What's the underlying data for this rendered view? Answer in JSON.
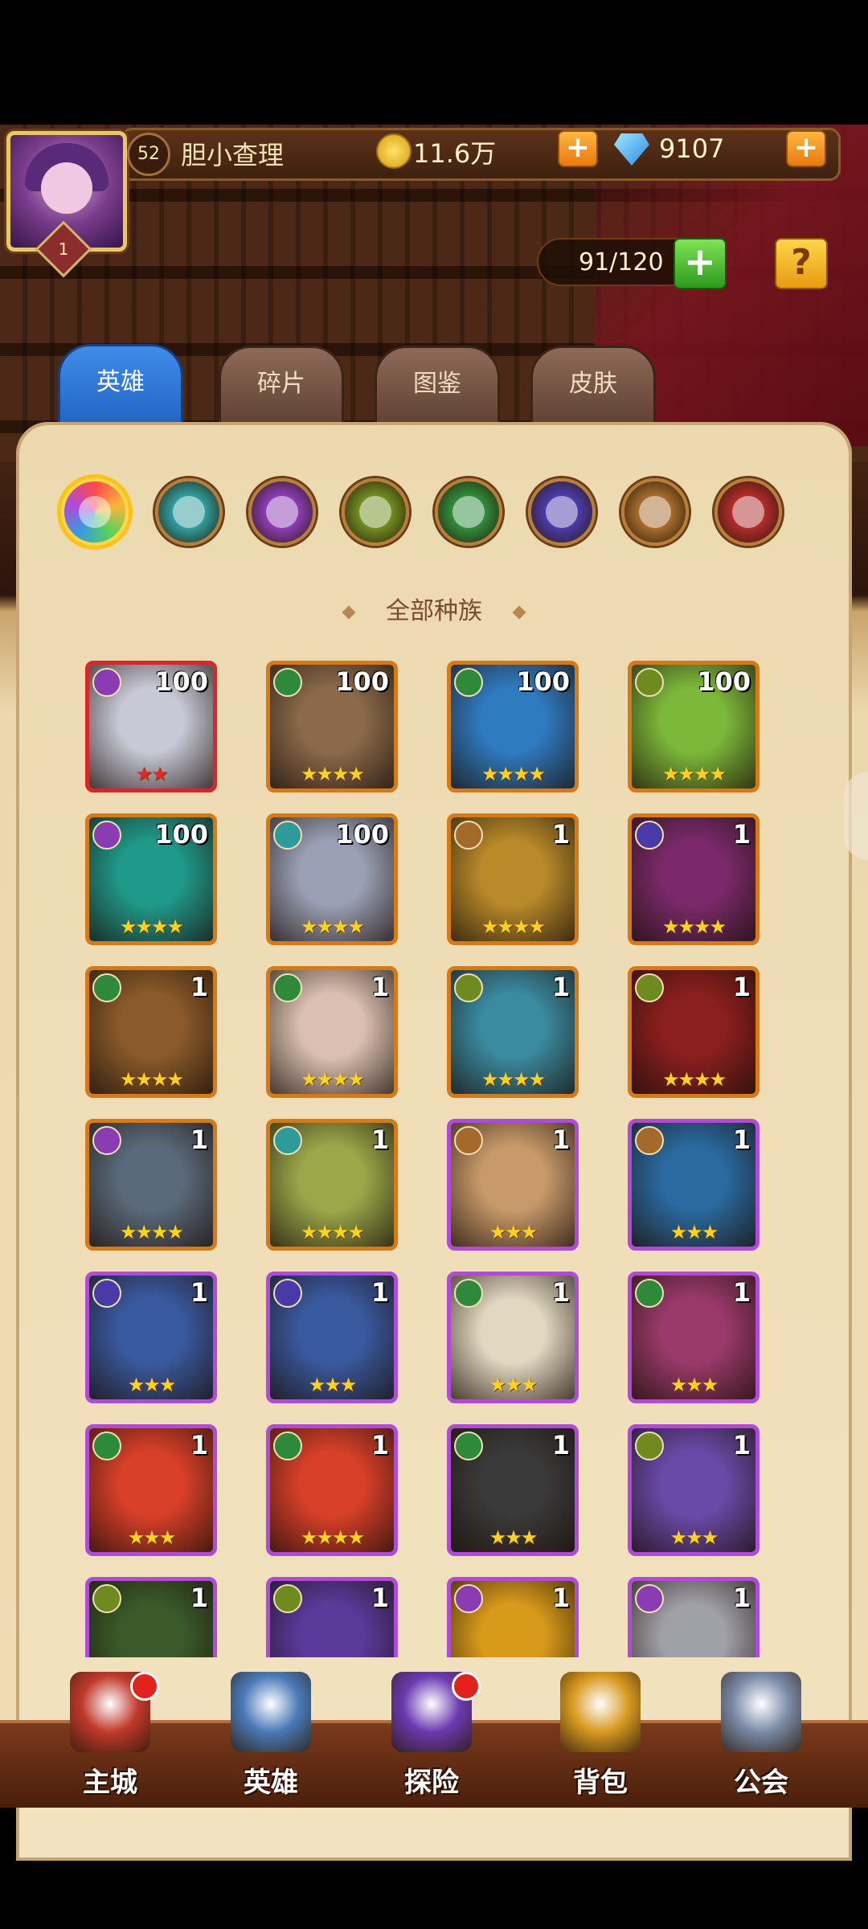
{
  "player": {
    "level": "52",
    "name": "胆小查理",
    "rank": "1"
  },
  "currency": {
    "gold": "11.6万",
    "gems": "9107"
  },
  "roster": {
    "count": "91/120"
  },
  "tabs": [
    "英雄",
    "碎片",
    "图鉴",
    "皮肤"
  ],
  "race_filter": {
    "title": "全部种族",
    "icons": [
      "all-races-icon",
      "race-blue-icon",
      "race-purple-icon",
      "race-olive-icon",
      "race-green-icon",
      "race-indigo-icon",
      "race-bronze-icon",
      "race-red-icon"
    ],
    "colors": [
      "#ff7e3a",
      "#2f9a9a",
      "#8a3cb2",
      "#6f8a1f",
      "#2e8a3a",
      "#4a3aa8",
      "#a46a2c",
      "#b02a2a"
    ]
  },
  "heroes": [
    {
      "level": "100",
      "stars": "★★",
      "frame": "red",
      "race": "#8a3cb2",
      "bg": "#c7c9d6"
    },
    {
      "level": "100",
      "stars": "★★★★",
      "frame": "orange",
      "race": "#2e8a3a",
      "bg": "#8a6a4a"
    },
    {
      "level": "100",
      "stars": "★★★★",
      "frame": "orange",
      "race": "#2e8a3a",
      "bg": "#2f7bc0"
    },
    {
      "level": "100",
      "stars": "★★★★",
      "frame": "orange",
      "race": "#6f8a1f",
      "bg": "#7cb83a"
    },
    {
      "level": "100",
      "stars": "★★★★",
      "frame": "orange",
      "race": "#8a3cb2",
      "bg": "#1f9a8a"
    },
    {
      "level": "100",
      "stars": "★★★★",
      "frame": "orange",
      "race": "#2f9a9a",
      "bg": "#9aa0b5"
    },
    {
      "level": "1",
      "stars": "★★★★",
      "frame": "orange",
      "race": "#a46a2c",
      "bg": "#b88a2a"
    },
    {
      "level": "1",
      "stars": "★★★★",
      "frame": "orange",
      "race": "#4a3aa8",
      "bg": "#7a2a6a"
    },
    {
      "level": "1",
      "stars": "★★★★",
      "frame": "orange",
      "race": "#2e8a3a",
      "bg": "#8a5a2a"
    },
    {
      "level": "1",
      "stars": "★★★★",
      "frame": "orange",
      "race": "#2e8a3a",
      "bg": "#d9c0b0"
    },
    {
      "level": "1",
      "stars": "★★★★",
      "frame": "orange",
      "race": "#6f8a1f",
      "bg": "#3a8aa0"
    },
    {
      "level": "1",
      "stars": "★★★★",
      "frame": "orange",
      "race": "#6f8a1f",
      "bg": "#8a1f1f"
    },
    {
      "level": "1",
      "stars": "★★★★",
      "frame": "orange",
      "race": "#8a3cb2",
      "bg": "#5a6a7a"
    },
    {
      "level": "1",
      "stars": "★★★★",
      "frame": "orange",
      "race": "#2f9a9a",
      "bg": "#9aa84a"
    },
    {
      "level": "1",
      "stars": "★★★",
      "frame": "purple",
      "race": "#a46a2c",
      "bg": "#c89a6a"
    },
    {
      "level": "1",
      "stars": "★★★",
      "frame": "purple",
      "race": "#a46a2c",
      "bg": "#2a6aa0"
    },
    {
      "level": "1",
      "stars": "★★★",
      "frame": "purple",
      "race": "#4a3aa8",
      "bg": "#3a5aa0"
    },
    {
      "level": "1",
      "stars": "★★★",
      "frame": "purple",
      "race": "#4a3aa8",
      "bg": "#3a5aa0"
    },
    {
      "level": "1",
      "stars": "★★★",
      "frame": "purple",
      "race": "#2e8a3a",
      "bg": "#e0d8c0"
    },
    {
      "level": "1",
      "stars": "★★★",
      "frame": "purple",
      "race": "#2e8a3a",
      "bg": "#9a3a6a"
    },
    {
      "level": "1",
      "stars": "★★★",
      "frame": "purple",
      "race": "#2e8a3a",
      "bg": "#d8402a"
    },
    {
      "level": "1",
      "stars": "★★★★",
      "frame": "purple",
      "race": "#2e8a3a",
      "bg": "#d8402a"
    },
    {
      "level": "1",
      "stars": "★★★",
      "frame": "purple",
      "race": "#2e8a3a",
      "bg": "#3a3a3a"
    },
    {
      "level": "1",
      "stars": "★★★",
      "frame": "purple",
      "race": "#6f8a1f",
      "bg": "#6a4aa8"
    },
    {
      "level": "1",
      "stars": "★★★",
      "frame": "purple",
      "race": "#6f8a1f",
      "bg": "#3a5a2a"
    },
    {
      "level": "1",
      "stars": "★★★",
      "frame": "purple",
      "race": "#6f8a1f",
      "bg": "#5a3a9a"
    },
    {
      "level": "1",
      "stars": "★★★",
      "frame": "purple",
      "race": "#8a3cb2",
      "bg": "#d89a1a"
    },
    {
      "level": "1",
      "stars": "★★★",
      "frame": "purple",
      "race": "#8a3cb2",
      "bg": "#a0a0a8"
    }
  ],
  "nav": [
    {
      "label": "主城",
      "icon": "castle-icon",
      "badge": true,
      "color": "#c0392b"
    },
    {
      "label": "英雄",
      "icon": "hero-icon",
      "badge": false,
      "color": "#4a7ab8"
    },
    {
      "label": "探险",
      "icon": "portal-icon",
      "badge": true,
      "color": "#6a3ab0"
    },
    {
      "label": "背包",
      "icon": "backpack-icon",
      "badge": false,
      "color": "#d89a20"
    },
    {
      "label": "公会",
      "icon": "guild-icon",
      "badge": false,
      "color": "#7a8aa8"
    }
  ]
}
